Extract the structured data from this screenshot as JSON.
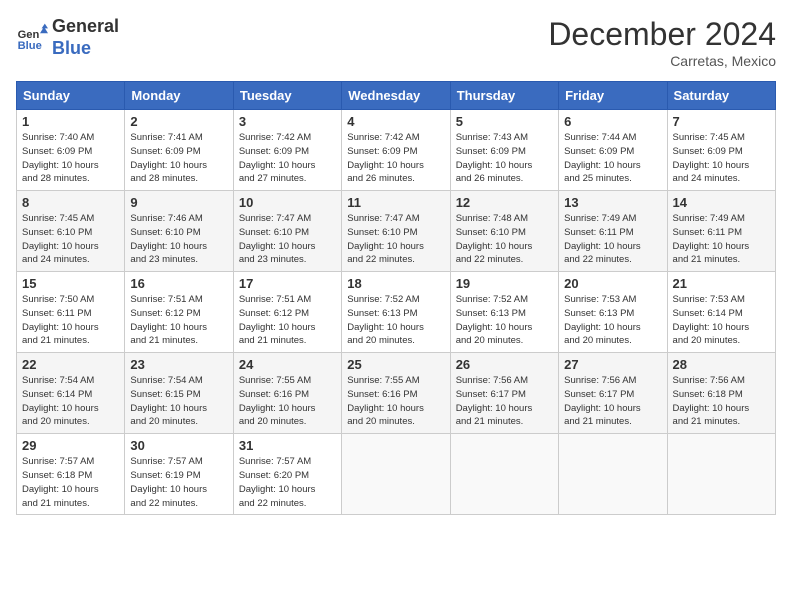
{
  "header": {
    "logo_line1": "General",
    "logo_line2": "Blue",
    "month": "December 2024",
    "location": "Carretas, Mexico"
  },
  "weekdays": [
    "Sunday",
    "Monday",
    "Tuesday",
    "Wednesday",
    "Thursday",
    "Friday",
    "Saturday"
  ],
  "weeks": [
    [
      {
        "day": "1",
        "info": "Sunrise: 7:40 AM\nSunset: 6:09 PM\nDaylight: 10 hours\nand 28 minutes."
      },
      {
        "day": "2",
        "info": "Sunrise: 7:41 AM\nSunset: 6:09 PM\nDaylight: 10 hours\nand 28 minutes."
      },
      {
        "day": "3",
        "info": "Sunrise: 7:42 AM\nSunset: 6:09 PM\nDaylight: 10 hours\nand 27 minutes."
      },
      {
        "day": "4",
        "info": "Sunrise: 7:42 AM\nSunset: 6:09 PM\nDaylight: 10 hours\nand 26 minutes."
      },
      {
        "day": "5",
        "info": "Sunrise: 7:43 AM\nSunset: 6:09 PM\nDaylight: 10 hours\nand 26 minutes."
      },
      {
        "day": "6",
        "info": "Sunrise: 7:44 AM\nSunset: 6:09 PM\nDaylight: 10 hours\nand 25 minutes."
      },
      {
        "day": "7",
        "info": "Sunrise: 7:45 AM\nSunset: 6:09 PM\nDaylight: 10 hours\nand 24 minutes."
      }
    ],
    [
      {
        "day": "8",
        "info": "Sunrise: 7:45 AM\nSunset: 6:10 PM\nDaylight: 10 hours\nand 24 minutes."
      },
      {
        "day": "9",
        "info": "Sunrise: 7:46 AM\nSunset: 6:10 PM\nDaylight: 10 hours\nand 23 minutes."
      },
      {
        "day": "10",
        "info": "Sunrise: 7:47 AM\nSunset: 6:10 PM\nDaylight: 10 hours\nand 23 minutes."
      },
      {
        "day": "11",
        "info": "Sunrise: 7:47 AM\nSunset: 6:10 PM\nDaylight: 10 hours\nand 22 minutes."
      },
      {
        "day": "12",
        "info": "Sunrise: 7:48 AM\nSunset: 6:10 PM\nDaylight: 10 hours\nand 22 minutes."
      },
      {
        "day": "13",
        "info": "Sunrise: 7:49 AM\nSunset: 6:11 PM\nDaylight: 10 hours\nand 22 minutes."
      },
      {
        "day": "14",
        "info": "Sunrise: 7:49 AM\nSunset: 6:11 PM\nDaylight: 10 hours\nand 21 minutes."
      }
    ],
    [
      {
        "day": "15",
        "info": "Sunrise: 7:50 AM\nSunset: 6:11 PM\nDaylight: 10 hours\nand 21 minutes."
      },
      {
        "day": "16",
        "info": "Sunrise: 7:51 AM\nSunset: 6:12 PM\nDaylight: 10 hours\nand 21 minutes."
      },
      {
        "day": "17",
        "info": "Sunrise: 7:51 AM\nSunset: 6:12 PM\nDaylight: 10 hours\nand 21 minutes."
      },
      {
        "day": "18",
        "info": "Sunrise: 7:52 AM\nSunset: 6:13 PM\nDaylight: 10 hours\nand 20 minutes."
      },
      {
        "day": "19",
        "info": "Sunrise: 7:52 AM\nSunset: 6:13 PM\nDaylight: 10 hours\nand 20 minutes."
      },
      {
        "day": "20",
        "info": "Sunrise: 7:53 AM\nSunset: 6:13 PM\nDaylight: 10 hours\nand 20 minutes."
      },
      {
        "day": "21",
        "info": "Sunrise: 7:53 AM\nSunset: 6:14 PM\nDaylight: 10 hours\nand 20 minutes."
      }
    ],
    [
      {
        "day": "22",
        "info": "Sunrise: 7:54 AM\nSunset: 6:14 PM\nDaylight: 10 hours\nand 20 minutes."
      },
      {
        "day": "23",
        "info": "Sunrise: 7:54 AM\nSunset: 6:15 PM\nDaylight: 10 hours\nand 20 minutes."
      },
      {
        "day": "24",
        "info": "Sunrise: 7:55 AM\nSunset: 6:16 PM\nDaylight: 10 hours\nand 20 minutes."
      },
      {
        "day": "25",
        "info": "Sunrise: 7:55 AM\nSunset: 6:16 PM\nDaylight: 10 hours\nand 20 minutes."
      },
      {
        "day": "26",
        "info": "Sunrise: 7:56 AM\nSunset: 6:17 PM\nDaylight: 10 hours\nand 21 minutes."
      },
      {
        "day": "27",
        "info": "Sunrise: 7:56 AM\nSunset: 6:17 PM\nDaylight: 10 hours\nand 21 minutes."
      },
      {
        "day": "28",
        "info": "Sunrise: 7:56 AM\nSunset: 6:18 PM\nDaylight: 10 hours\nand 21 minutes."
      }
    ],
    [
      {
        "day": "29",
        "info": "Sunrise: 7:57 AM\nSunset: 6:18 PM\nDaylight: 10 hours\nand 21 minutes."
      },
      {
        "day": "30",
        "info": "Sunrise: 7:57 AM\nSunset: 6:19 PM\nDaylight: 10 hours\nand 22 minutes."
      },
      {
        "day": "31",
        "info": "Sunrise: 7:57 AM\nSunset: 6:20 PM\nDaylight: 10 hours\nand 22 minutes."
      },
      null,
      null,
      null,
      null
    ]
  ]
}
